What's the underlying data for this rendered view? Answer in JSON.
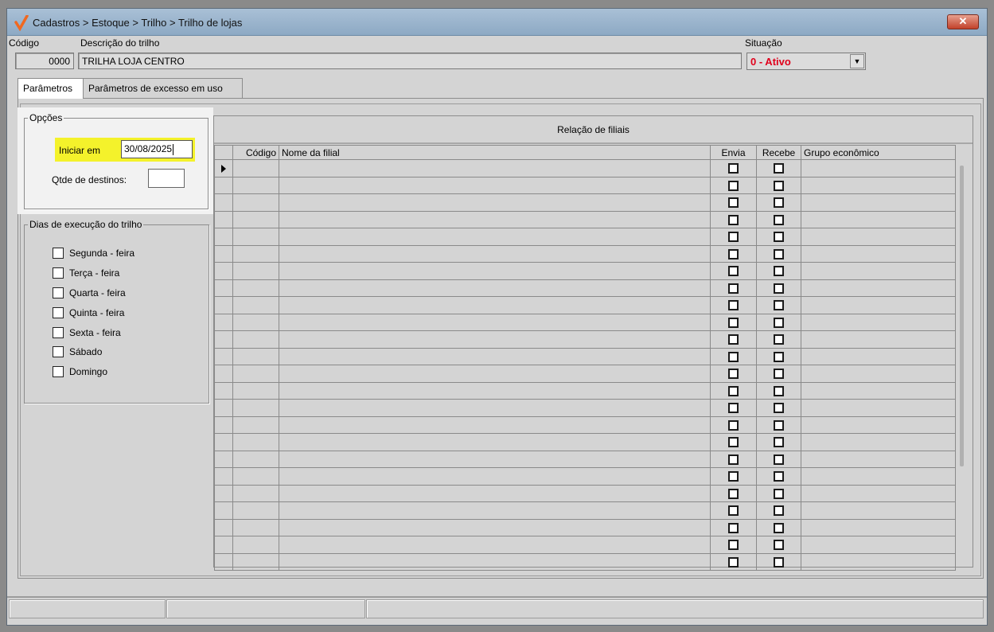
{
  "window": {
    "title": "Cadastros > Estoque > Trilho > Trilho de lojas",
    "close_label": "✕"
  },
  "header": {
    "codigo_label": "Código",
    "codigo_value": "0000",
    "descricao_label": "Descrição do trilho",
    "descricao_value": "TRILHA LOJA CENTRO",
    "situacao_label": "Situação",
    "situacao_value": "0 - Ativo"
  },
  "tabs": [
    {
      "label": "Parâmetros",
      "active": true
    },
    {
      "label": "Parâmetros de excesso em uso",
      "active": false
    }
  ],
  "opcoes": {
    "legend": "Opções",
    "iniciar_label": "Iniciar em",
    "iniciar_value": "30/08/2025",
    "qtde_label": "Qtde de destinos:",
    "qtde_value": ""
  },
  "dias": {
    "legend": "Dias de execução do trilho",
    "items": [
      {
        "label": "Segunda - feira",
        "checked": false
      },
      {
        "label": "Terça - feira",
        "checked": false
      },
      {
        "label": "Quarta - feira",
        "checked": false
      },
      {
        "label": "Quinta - feira",
        "checked": false
      },
      {
        "label": "Sexta - feira",
        "checked": false
      },
      {
        "label": "Sábado",
        "checked": false
      },
      {
        "label": "Domingo",
        "checked": false
      }
    ]
  },
  "grid": {
    "title": "Relação de filiais",
    "columns": [
      "Código",
      "Nome da filial",
      "Envia",
      "Recebe",
      "Grupo econômico"
    ],
    "row_count": 24
  },
  "colors": {
    "highlight": "#f4f22b",
    "status_active": "#e0001b"
  }
}
